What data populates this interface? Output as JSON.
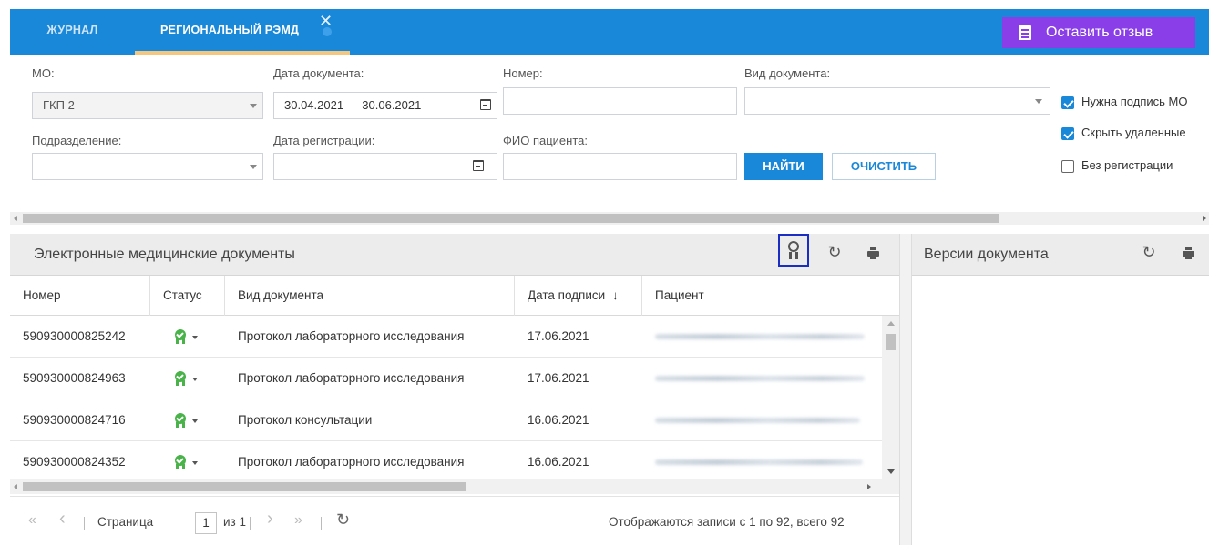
{
  "tabs": {
    "journal": "ЖУРНАЛ",
    "remd": "РЕГИОНАЛЬНЫЙ РЭМД",
    "close_glyph": "✕"
  },
  "feedback_button": "Оставить отзыв",
  "filters": {
    "mo_label": "МО:",
    "mo_value": "ГКП 2",
    "doc_date_label": "Дата документа:",
    "doc_date_value": "30.04.2021 — 30.06.2021",
    "number_label": "Номер:",
    "number_value": "",
    "doc_type_label": "Вид документа:",
    "doc_type_value": "",
    "subdivision_label": "Подразделение:",
    "subdivision_value": "",
    "reg_date_label": "Дата регистрации:",
    "reg_date_value": "",
    "patient_label": "ФИО пациента:",
    "patient_value": "",
    "find_button": "НАЙТИ",
    "clear_button": "ОЧИСТИТЬ"
  },
  "checkboxes": [
    {
      "label": "Нужна подпись МО",
      "checked": true
    },
    {
      "label": "Скрыть удаленные",
      "checked": true
    },
    {
      "label": "Без регистрации",
      "checked": false
    }
  ],
  "documents_panel": {
    "title": "Электронные медицинские документы",
    "columns": [
      "Номер",
      "Статус",
      "Вид документа",
      "Дата подписи",
      "Пациент"
    ],
    "sort_indicator": "↓",
    "rows": [
      {
        "number": "590930000825242",
        "doc_type": "Протокол лабораторного исследования",
        "date": "17.06.2021"
      },
      {
        "number": "590930000824963",
        "doc_type": "Протокол лабораторного исследования",
        "date": "17.06.2021"
      },
      {
        "number": "590930000824716",
        "doc_type": "Протокол консультации",
        "date": "16.06.2021"
      },
      {
        "number": "590930000824352",
        "doc_type": "Протокол лабораторного исследования",
        "date": "16.06.2021"
      }
    ]
  },
  "pager": {
    "first": "«",
    "prev": "‹",
    "page_label": "Страница",
    "page_value": "1",
    "of_label": "из 1",
    "next": "›",
    "last": "»",
    "records_text": "Отображаются записи с 1 по 92, всего 92"
  },
  "versions_panel": {
    "title": "Версии документа"
  },
  "icons": {
    "refresh": "↻"
  },
  "colors": {
    "accent": "#1a88d9",
    "feedback": "#8a3ee8",
    "status_ok": "#49b34a",
    "highlight": "#1b2ec4"
  }
}
